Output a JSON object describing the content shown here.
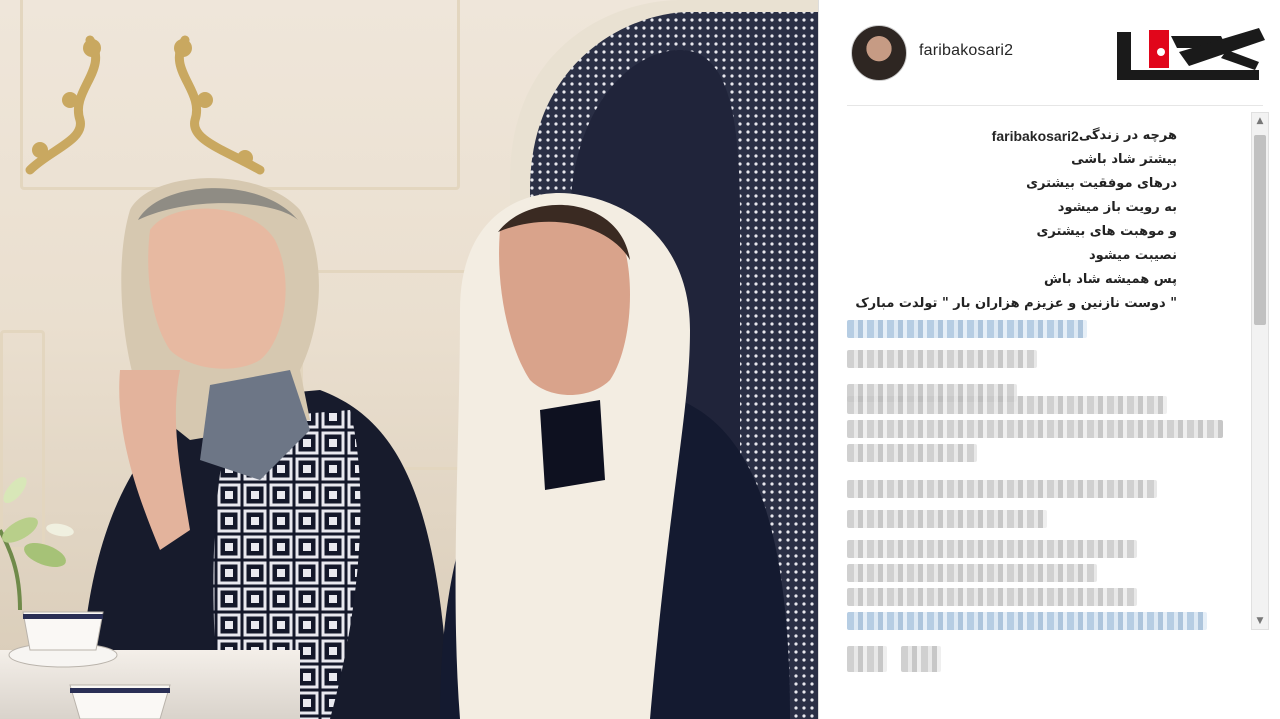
{
  "post": {
    "username": "faribakosari2",
    "logo_alt": "rokna logo",
    "caption": {
      "username": "faribakosari2",
      "lines": [
        "هرچه در زندگی",
        "بیشتر شاد باشی",
        "درهای موفقیت بیشتری",
        "به رویت باز میشود",
        "و موهبت های بیشتری",
        "نصیبت میشود",
        "پس همیشه شاد باش",
        "\" دوست نازنین و عزیزم هزاران بار \" تولدت مبارک"
      ]
    }
  },
  "colors": {
    "logo_red": "#e1061b",
    "logo_black": "#1a1a1a",
    "text": "#262626"
  },
  "icons": {
    "scroll_up": "▲",
    "scroll_down": "▼"
  }
}
